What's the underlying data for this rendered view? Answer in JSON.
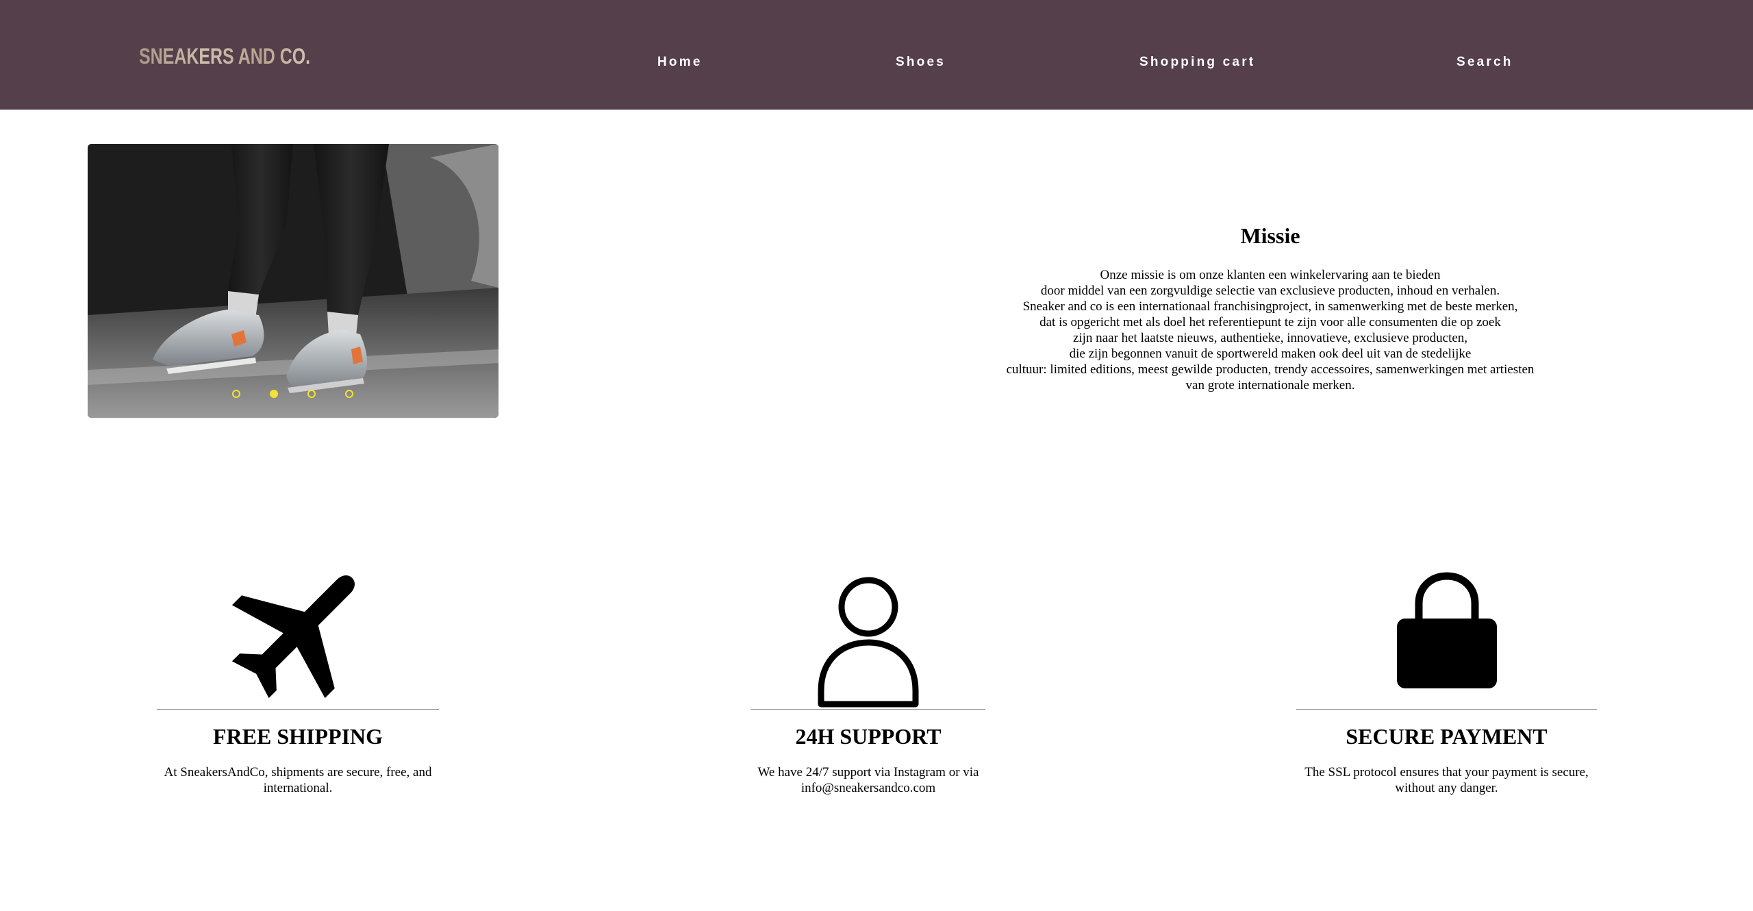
{
  "brand": {
    "logo_text": "SNEAKERS AND CO."
  },
  "nav": {
    "items": [
      {
        "label": "Home"
      },
      {
        "label": "Shoes"
      },
      {
        "label": "Shopping cart"
      },
      {
        "label": "Search"
      }
    ]
  },
  "slider": {
    "slide_count": 4,
    "active_index": 1,
    "image": "sneakers-photo"
  },
  "mission": {
    "title": "Missie",
    "lines": [
      "Onze missie is om onze klanten een winkelervaring aan te bieden",
      "door middel van een zorgvuldige selectie van exclusieve producten, inhoud en verhalen.",
      "Sneaker and co is een internationaal franchisingproject, in samenwerking met de beste merken,",
      "dat is opgericht met als doel het referentiepunt te zijn voor alle consumenten die op zoek",
      "zijn naar het laatste nieuws, authentieke, innovatieve, exclusieve producten,",
      "die zijn begonnen vanuit de sportwereld maken ook deel uit van de stedelijke",
      "cultuur: limited editions, meest gewilde producten, trendy accessoires, samenwerkingen met artiesten",
      "van grote internationale merken."
    ]
  },
  "features": [
    {
      "icon": "airplane-icon",
      "title": "FREE SHIPPING",
      "text": "At SneakersAndCo, shipments are secure, free, and international."
    },
    {
      "icon": "user-icon",
      "title": "24H SUPPORT",
      "text": "We have 24/7 support via Instagram or via info@sneakersandco.com"
    },
    {
      "icon": "lock-icon",
      "title": "SECURE PAYMENT",
      "text": "The SSL protocol ensures that your payment is secure, without any danger."
    }
  ],
  "colors": {
    "header_bg": "#553f4b",
    "nav_text": "#ffffff",
    "slider_dot": "#f2e432"
  }
}
